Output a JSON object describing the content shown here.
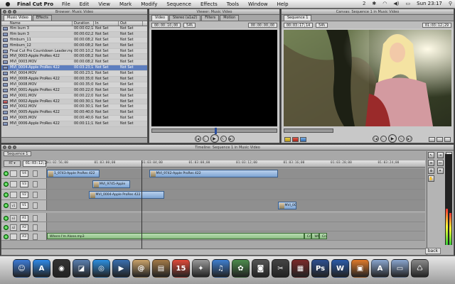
{
  "menubar": {
    "app_name": "Final Cut Pro",
    "items": [
      "File",
      "Edit",
      "View",
      "Mark",
      "Modify",
      "Sequence",
      "Effects",
      "Tools",
      "Window",
      "Help"
    ],
    "status_number": "2",
    "clock": "Sun 23:17"
  },
  "browser": {
    "title": "Browser: Music Video",
    "tabs": [
      "Music Video",
      "Effects"
    ],
    "columns": [
      "Name",
      "Duration",
      "In",
      "Out"
    ],
    "rows": [
      {
        "name": "film bum 3",
        "duration": "00:00:02;18",
        "in": "Not Set",
        "out": "Not Set",
        "red": false,
        "selected": false
      },
      {
        "name": "film bum 3",
        "duration": "00:00:02;23",
        "in": "Not Set",
        "out": "Not Set",
        "red": false,
        "selected": false
      },
      {
        "name": "filmburn_11",
        "duration": "00:00:08;23",
        "in": "Not Set",
        "out": "Not Set",
        "red": false,
        "selected": false
      },
      {
        "name": "filmburn_12",
        "duration": "00:00:08;23",
        "in": "Not Set",
        "out": "Not Set",
        "red": false,
        "selected": false
      },
      {
        "name": "Final Cut Pro Countdown Leader.mp4",
        "duration": "00:00:10;22",
        "in": "Not Set",
        "out": "Not Set",
        "red": false,
        "selected": false
      },
      {
        "name": "MVI_0003-Apple ProRes 422",
        "duration": "00:00:08;23",
        "in": "Not Set",
        "out": "Not Set",
        "red": false,
        "selected": false
      },
      {
        "name": "MVI_0003.MOV",
        "duration": "00:00:08;23",
        "in": "Not Set",
        "out": "Not Set",
        "red": false,
        "selected": false
      },
      {
        "name": "MVI_0004-Apple ProRes 422",
        "duration": "00:03:23;13",
        "in": "Not Set",
        "out": "Not Set",
        "red": false,
        "selected": true
      },
      {
        "name": "MVI_0004.MOV",
        "duration": "00:00:23;13",
        "in": "Not Set",
        "out": "Not Set",
        "red": false,
        "selected": false
      },
      {
        "name": "MVI_0008-Apple ProRes 422",
        "duration": "00:00:35;05",
        "in": "Not Set",
        "out": "Not Set",
        "red": false,
        "selected": false
      },
      {
        "name": "MVI_0008.MOV",
        "duration": "00:00:35;05",
        "in": "Not Set",
        "out": "Not Set",
        "red": false,
        "selected": false
      },
      {
        "name": "MVI_0001-Apple ProRes 422",
        "duration": "00:00:22;01",
        "in": "Not Set",
        "out": "Not Set",
        "red": false,
        "selected": false
      },
      {
        "name": "MVI_0001.MOV",
        "duration": "00:00:22;01",
        "in": "Not Set",
        "out": "Not Set",
        "red": false,
        "selected": false
      },
      {
        "name": "MVI_0002-Apple ProRes 422",
        "duration": "00:00:30;12",
        "in": "Not Set",
        "out": "Not Set",
        "red": true,
        "selected": false
      },
      {
        "name": "MVI_0002.MOV",
        "duration": "00:00:30;12",
        "in": "Not Set",
        "out": "Not Set",
        "red": false,
        "selected": false
      },
      {
        "name": "MVI_0005-Apple ProRes 422",
        "duration": "00:00:40;04",
        "in": "Not Set",
        "out": "Not Set",
        "red": false,
        "selected": false
      },
      {
        "name": "MVI_0005.MOV",
        "duration": "00:00:40;04",
        "in": "Not Set",
        "out": "Not Set",
        "red": false,
        "selected": false
      },
      {
        "name": "MVI_0006-Apple ProRes 422",
        "duration": "00:00:11;12",
        "in": "Not Set",
        "out": "Not Set",
        "red": false,
        "selected": false
      }
    ]
  },
  "viewer": {
    "title": "Viewer: Music Video",
    "tabs": [
      "Video",
      "Stereo (a1a2)",
      "Filters",
      "Motion"
    ],
    "timecode_left": "00:00:10;00",
    "timecode_right": "00:00:00;00",
    "zoom": "54%"
  },
  "canvas": {
    "title": "Canvas: Sequence 1 in Music Video",
    "tab": "Sequence 1",
    "timecode_left": "00:03:17;14",
    "timecode_right": "01:03:12;29",
    "zoom": "54%"
  },
  "timeline": {
    "title": "Timeline: Sequence 1 in Music Video",
    "sequence_tab": "Sequence 1",
    "timecode": "01:03:12;29",
    "ruler_ticks": [
      "01:02:56;00",
      "01:03:00;00",
      "01:03:04;00",
      "01:03:08;00",
      "01:03:12;00",
      "01:03:16;00",
      "01:03:20;00",
      "01:03:24;00"
    ],
    "video_tracks": [
      {
        "name": "V4",
        "src": "",
        "clips": [
          {
            "label": "1_9743-Apple ProRes 422",
            "start": 0.0,
            "end": 0.14
          },
          {
            "label": "MVI_9742-Apple ProRes 422",
            "start": 0.27,
            "end": 0.61
          }
        ]
      },
      {
        "name": "V3",
        "src": "",
        "clips": [
          {
            "label": "MVI_9745-Apple",
            "start": 0.12,
            "end": 0.22
          }
        ]
      },
      {
        "name": "V2",
        "src": "",
        "clips": [
          {
            "label": "MVI_0004-Apple ProRes 422",
            "start": 0.11,
            "end": 0.31
          }
        ]
      },
      {
        "name": "V1",
        "src": "v1",
        "clips": [
          {
            "label": "MVI_000",
            "start": 0.61,
            "end": 0.66
          }
        ]
      }
    ],
    "audio_tracks": [
      {
        "name": "A1",
        "src": "a1",
        "clips": []
      },
      {
        "name": "A2",
        "src": "a2",
        "clips": []
      },
      {
        "name": "A3",
        "src": "",
        "clips": [
          {
            "label": "Where I'm Alone.mp3",
            "start": 0.0,
            "end": 0.68
          },
          {
            "label": "Cro",
            "start": 0.68,
            "end": 0.7
          },
          {
            "label": "Wh",
            "start": 0.7,
            "end": 0.72
          },
          {
            "label": "Cro",
            "start": 0.72,
            "end": 0.74
          }
        ]
      }
    ],
    "playhead": 0.25
  },
  "dock": {
    "tooltip": "back",
    "icons": [
      {
        "name": "finder-icon",
        "glyph": "☺",
        "color": "#3d7bd6"
      },
      {
        "name": "appstore-icon",
        "glyph": "A",
        "color": "#2f8ae8"
      },
      {
        "name": "dashboard-icon",
        "glyph": "◉",
        "color": "#333333"
      },
      {
        "name": "preview-icon",
        "glyph": "◪",
        "color": "#5a7fb0"
      },
      {
        "name": "safari-icon",
        "glyph": "◎",
        "color": "#2d8fe0"
      },
      {
        "name": "facetime-icon",
        "glyph": "▶",
        "color": "#3a6fb0"
      },
      {
        "name": "contacts-icon",
        "glyph": "@",
        "color": "#c9a36a"
      },
      {
        "name": "addressbook-icon",
        "glyph": "▤",
        "color": "#a37a48"
      },
      {
        "name": "ical-icon",
        "glyph": "15",
        "color": "#e04a3a"
      },
      {
        "name": "photobooth-icon",
        "glyph": "✦",
        "color": "#9a9a9a"
      },
      {
        "name": "itunes-icon",
        "glyph": "♫",
        "color": "#3f7fd0"
      },
      {
        "name": "iphoto-icon",
        "glyph": "✿",
        "color": "#4d8c4d"
      },
      {
        "name": "camera-icon",
        "glyph": "◙",
        "color": "#555555"
      },
      {
        "name": "finalcut-icon",
        "glyph": "✂",
        "color": "#444444"
      },
      {
        "name": "compressor-icon",
        "glyph": "▦",
        "color": "#7a2a2a"
      },
      {
        "name": "photoshop-icon",
        "glyph": "Ps",
        "color": "#2d4f8f"
      },
      {
        "name": "word-icon",
        "glyph": "W",
        "color": "#2a5aa8"
      },
      {
        "name": "frame-icon",
        "glyph": "▣",
        "color": "#e07a2a"
      },
      {
        "name": "applications-folder-icon",
        "glyph": "A",
        "color": "#8aa6cf"
      },
      {
        "name": "documents-folder-icon",
        "glyph": "▭",
        "color": "#8aa6cf"
      },
      {
        "name": "trash-icon",
        "glyph": "♺",
        "color": "#8a8a8a"
      }
    ]
  }
}
